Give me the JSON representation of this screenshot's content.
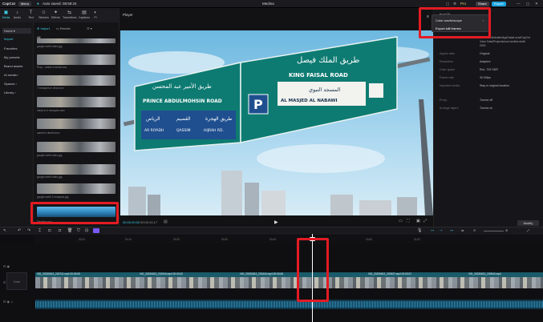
{
  "titlebar": {
    "app_name": "CapCut",
    "menu_label": "Menu",
    "autosave_text": "Auto saved: 08:58:24",
    "project_title": "Medina",
    "pro_label": "Pro",
    "share_label": "Share",
    "export_label": "Export"
  },
  "tools": [
    {
      "label": "Media",
      "icon": "media-icon"
    },
    {
      "label": "Audio",
      "icon": "audio-icon"
    },
    {
      "label": "Text",
      "icon": "text-icon"
    },
    {
      "label": "Stickers",
      "icon": "stickers-icon"
    },
    {
      "label": "Effects",
      "icon": "effects-icon"
    },
    {
      "label": "Transitions",
      "icon": "transitions-icon"
    },
    {
      "label": "Captions",
      "icon": "captions-icon"
    },
    {
      "label": "Fi",
      "icon": "filters-icon"
    }
  ],
  "sidebar": {
    "items": [
      "Home",
      "Import",
      "Favorites",
      "My presets",
      "Brand assets",
      "AI media",
      "Spaces",
      "Library"
    ]
  },
  "media": {
    "import_label": "Import",
    "render_label": "Render",
    "all_label": "All",
    "file_labels": [
      "google earth video.jpg",
      "Prop... street in dubai.mov",
      "7 mosques in clear.mov",
      "dubai-in 4 mosques.mov",
      "camel in desert.mov",
      "google earth video.jpg",
      "google earth video.jpg",
      "google earth 2 mosques.jpg",
      "Timeline.mov"
    ]
  },
  "player": {
    "label": "Player",
    "current_time": "00:00:00:00",
    "total_time": "00:00:24:17"
  },
  "details": {
    "title": "Details",
    "path_line1": "C:/Users/Abdullah/AppData/Local/CapCut",
    "path_line2": "/User Data/Projects/com.lveditor.draft/",
    "path_line3": "0302",
    "rows": [
      {
        "label": "Aspect ratio",
        "value": "Original"
      },
      {
        "label": "Resolution",
        "value": "Adapted"
      },
      {
        "label": "Color space",
        "value": "Rec. 709 SDR"
      },
      {
        "label": "Frame rate",
        "value": "30.00fps"
      },
      {
        "label": "Imported media",
        "value": "Stay in original location"
      },
      {
        "label": "Proxy",
        "value": "Turned off"
      },
      {
        "label": "Arrange layers",
        "value": "Turned on"
      }
    ],
    "modify_label": "Modify"
  },
  "context_menu": {
    "items": [
      "Color wavfo/scope",
      "Export still frames"
    ]
  },
  "sign": {
    "left_ar": "طريق الأمير عبد المحسن",
    "left_en": "PRINCE ABDULMOHSIN ROAD",
    "left_dest1_ar": "الرياض",
    "left_dest1_en": "AR RIYADH",
    "left_dest2_ar": "القصيم",
    "left_dest2_en": "QASSIM",
    "left_dest3_ar": "طريق الهجرة",
    "left_dest3_en": "HIJRAH RD.",
    "right_ar": "طريق الملك فيصل",
    "right_en": "KING FAISAL ROAD",
    "right_sub_ar": "المسجد النبوي",
    "right_sub_en": "AL MASJED AL NABAWI",
    "parking": "P"
  },
  "timeline": {
    "ruler_labels": [
      "00:00",
      "00:10",
      "00:20",
      "00:30",
      "00:40",
      "00:50",
      "00:60",
      "01:00"
    ],
    "clip_names": [
      "VID_20230813_200711.mp4  00:03:05",
      "VID_20230813_200715.mp4",
      "VID_20230813_201944.mp4  00:00:02",
      "VID_20230813_202438.mp4",
      "VID_20230813_202440.mp4  00:00:06",
      "VID_20230813_200937.mp4  00:00:07",
      "VID_20230813_200940.mp4"
    ]
  },
  "colors": {
    "accent": "#3ad1e6",
    "highlight": "#e31b23",
    "export_btn": "#19a4e0",
    "sign_green": "#0e7b72"
  }
}
